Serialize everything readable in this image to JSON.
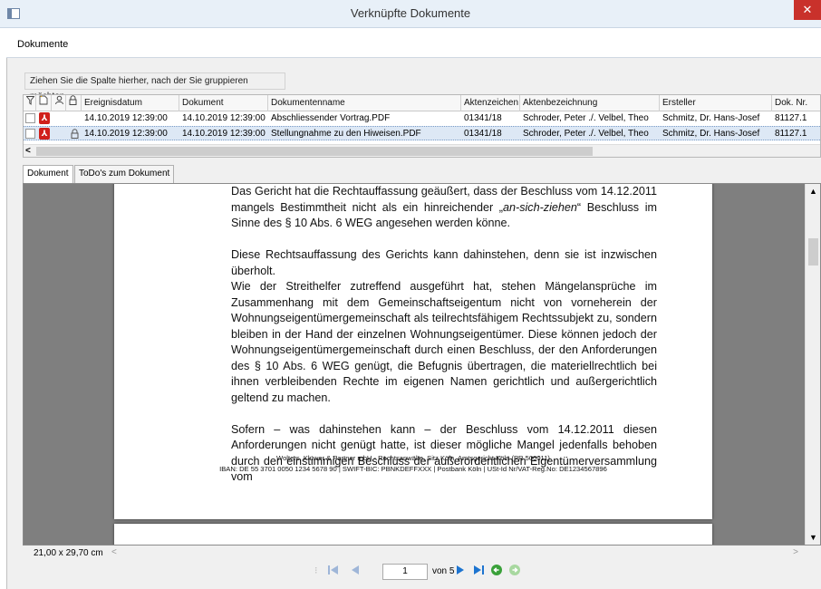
{
  "window": {
    "title": "Verknüpfte Dokumente"
  },
  "menu": {
    "item": "Dokumente"
  },
  "grid": {
    "group_hint": "Ziehen Sie die Spalte hierher, nach der Sie gruppieren möchten.",
    "columns": [
      "Ereignisdatum",
      "Dokument",
      "Dokumentenname",
      "Aktenzeichen",
      "Aktenbezeichnung",
      "Ersteller",
      "Dok. Nr."
    ],
    "rows": [
      {
        "ereignisdatum": "14.10.2019 12:39:00",
        "dokument": "14.10.2019 12:39:00",
        "name": "Abschliessender Vortrag.PDF",
        "aktenzeichen": "01341/18",
        "aktenbezeichnung": "Schroder, Peter ./. Velbel, Theo",
        "ersteller": "Schmitz, Dr. Hans-Josef",
        "doknr": "81127.1",
        "locked": false
      },
      {
        "ereignisdatum": "14.10.2019 12:39:00",
        "dokument": "14.10.2019 12:39:00",
        "name": "Stellungnahme zu den Hiweisen.PDF",
        "aktenzeichen": "01341/18",
        "aktenbezeichnung": "Schroder, Peter ./. Velbel, Theo",
        "ersteller": "Schmitz, Dr. Hans-Josef",
        "doknr": "81127.1",
        "locked": true
      }
    ],
    "scroll_left_glyph": "<"
  },
  "tabs": [
    {
      "label": "Dokument",
      "active": true
    },
    {
      "label": "ToDo's zum Dokument",
      "active": false
    }
  ],
  "document": {
    "p1a": "Das Gericht hat die Rechtauffassung geäußert, dass der Beschluss vom 14.12.2011 mangels Bestimmtheit nicht als ein hinreichender „",
    "p1_em": "an-sich-ziehen",
    "p1b": "“ Beschluss im Sinne des § 10 Abs. 6 WEG angesehen werden könne.",
    "p2": "Diese Rechtsauffassung des Gerichts kann dahinstehen, denn sie ist inzwischen überholt.",
    "p3": "Wie der Streithelfer zutreffend ausgeführt hat, stehen Mängelansprüche im Zusammenhang mit dem Gemeinschaftseigentum nicht von vorneherein der Wohnungseigentümergemeinschaft als teilrechtsfähigem Rechtssubjekt zu, sondern bleiben in der Hand der einzelnen Wohnungseigentümer. Diese können jedoch der Wohnungseigentümergemeinschaft durch einen Beschluss, der den Anforderungen des § 10 Abs. 6 WEG genügt, die Befugnis übertragen, die materiellrechtlich bei ihnen verbleibenden Rechte im eigenen Namen gerichtlich und außergerichtlich geltend zu machen.",
    "p4": "Sofern – was dahinstehen kann – der Beschluss vom 14.12.2011 diesen Anforderungen nicht genügt hatte, ist dieser mögliche Mangel jedenfalls behoben durch den einstimmigen Beschluss der außerordentlichen Eigentümerversammlung vom",
    "footer1": "Wolters, Kluwer & Partner mbH - Rechtsanwälte, Sitz Köln, Amtsgericht Köln (PR 500011)",
    "footer2": "IBAN: DE 55 3701 0050 1234 5678 90 | SWIFT-BIC: PBNKDEFFXXX | Postbank Köln | USt-Id Nr/VAT-Reg.No: DE1234567896"
  },
  "status": {
    "page_size": "21,00 x 29,70 cm"
  },
  "nav": {
    "current_page": "1",
    "of_label": "von 5"
  },
  "colors": {
    "pdf_red": "#d0201b",
    "nav_blue": "#1d74d0",
    "nav_green": "#3aa13a",
    "close_red": "#c9312b"
  }
}
